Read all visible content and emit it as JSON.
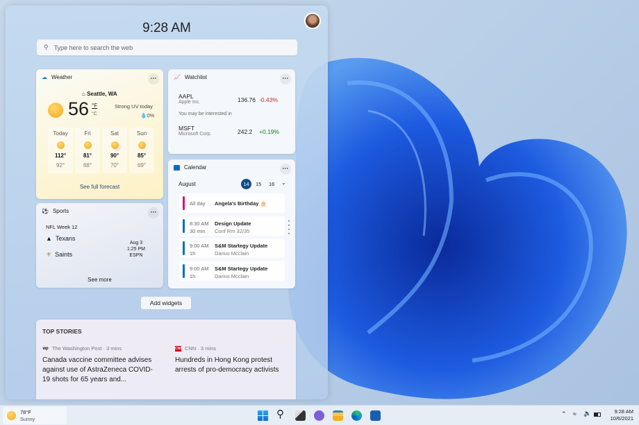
{
  "clock": "9:28 AM",
  "search": {
    "placeholder": "Type here to search the web"
  },
  "weather": {
    "title": "Weather",
    "location": "Seattle, WA",
    "temp": "56",
    "unit_f": "°F",
    "unit_c": "°C",
    "uv": "Strong UV today",
    "precip": "0%",
    "days": [
      {
        "name": "Today",
        "high": "112°",
        "low": "92°",
        "icon": "sunny"
      },
      {
        "name": "Fri",
        "high": "81°",
        "low": "68°",
        "icon": "sunny"
      },
      {
        "name": "Sat",
        "high": "90°",
        "low": "70°",
        "icon": "partly-cloudy"
      },
      {
        "name": "Sun",
        "high": "85°",
        "low": "69°",
        "icon": "sunny"
      }
    ],
    "link": "See full forecast"
  },
  "watchlist": {
    "title": "Watchlist",
    "stocks": [
      {
        "symbol": "AAPL",
        "name": "Apple Inc.",
        "price": "136.76",
        "change": "-0.43%",
        "color": "#c42b1c"
      },
      {
        "symbol": "MSFT",
        "name": "Microsoft Corp.",
        "price": "242.2",
        "change": "+0.19%",
        "color": "#0f7b0f"
      }
    ],
    "suggest": "You may be interested in"
  },
  "sports": {
    "title": "Sports",
    "league": "NFL Week 12",
    "team1": "Texans",
    "team2": "Saints",
    "date": "Aug 3",
    "time": "1:25 PM",
    "channel": "ESPN",
    "link": "See more"
  },
  "calendar": {
    "title": "Calendar",
    "month": "August",
    "days": [
      "14",
      "15",
      "16"
    ],
    "events": [
      {
        "time": "All day",
        "dur": "",
        "title": "Angela's Birthday",
        "sub": "",
        "color": "#d4157b"
      },
      {
        "time": "8:30 AM",
        "dur": "30 min",
        "title": "Design Update",
        "sub": "Conf Rm 32/35",
        "color": "#0f6cbd"
      },
      {
        "time": "9:00 AM",
        "dur": "1h",
        "title": "S&M Startegy Update",
        "sub": "Darius Mcclain",
        "color": "#0f6cbd"
      },
      {
        "time": "9:00 AM",
        "dur": "1h",
        "title": "S&M Startegy Update",
        "sub": "Darius Mcclain",
        "color": "#0f6cbd"
      }
    ]
  },
  "add_widgets": "Add widgets",
  "stories": {
    "title": "TOP STORIES",
    "items": [
      {
        "source": "The Washington Post · 3 mins",
        "headline": "Canada vaccine committee advises against use of AstraZeneca COVID-19 shots for 65 years and..."
      },
      {
        "source": "CNN · 3 mins",
        "headline": "Hundreds in Hong Kong protest arrests of pro-democracy activists"
      }
    ]
  },
  "taskbar": {
    "weather_temp": "78°F",
    "weather_cond": "Sunny",
    "time": "9:28 AM",
    "date": "10/6/2021",
    "apps": [
      "start",
      "search",
      "task-view",
      "teams-chat",
      "file-explorer",
      "edge",
      "store"
    ]
  }
}
